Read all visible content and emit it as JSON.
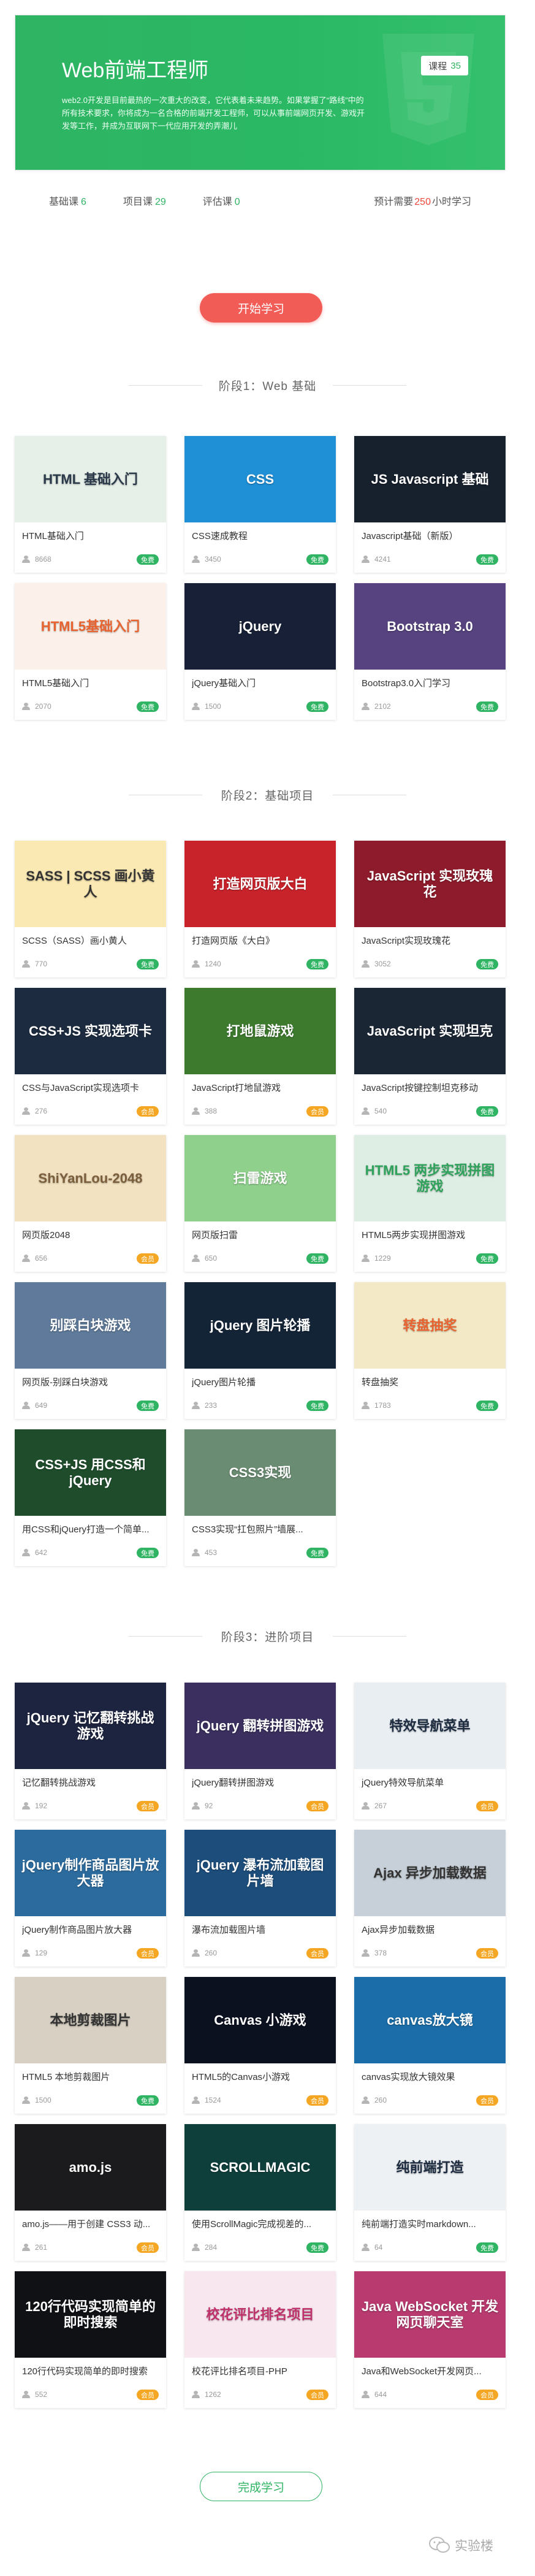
{
  "path": {
    "title": "Web前端工程师",
    "badge_label": "课程",
    "badge_count": "35",
    "description": "web2.0开发是目前最热的一次重大的改变，它代表着未来趋势。如果掌握了“路线”中的所有技术要求，你将成为一名合格的前端开发工程师，可以从事前端网页开发、游戏开发等工作，并成为互联网下一代应用开发的弄潮儿",
    "stats": [
      {
        "label": "基础课",
        "value": "6"
      },
      {
        "label": "项目课",
        "value": "29"
      },
      {
        "label": "评估课",
        "value": "0"
      }
    ],
    "estimate_prefix": "预计需要",
    "estimate_value": "250",
    "estimate_suffix": "小时学习"
  },
  "buttons": {
    "start": "开始学习",
    "finish": "完成学习"
  },
  "stages": [
    {
      "title": "阶段1：Web 基础",
      "courses": [
        {
          "title": "HTML基础入门",
          "learners": "8668",
          "badge": "免费",
          "thumb": {
            "text": "HTML 基础入门",
            "bg": "#e7efe9",
            "fg": "#2b3a4a"
          }
        },
        {
          "title": "CSS速成教程",
          "learners": "3450",
          "badge": "免费",
          "thumb": {
            "text": "CSS",
            "bg": "#1f8fd6",
            "fg": "#ffffff"
          }
        },
        {
          "title": "Javascript基础（新版）",
          "learners": "4241",
          "badge": "免费",
          "thumb": {
            "text": "JS Javascript 基础",
            "bg": "#17202d",
            "fg": "#ffffff"
          }
        },
        {
          "title": "HTML5基础入门",
          "learners": "2070",
          "badge": "免费",
          "thumb": {
            "text": "HTML5基础入门",
            "bg": "#fbf1ea",
            "fg": "#e8632f"
          }
        },
        {
          "title": "jQuery基础入门",
          "learners": "1500",
          "badge": "免费",
          "thumb": {
            "text": "jQuery",
            "bg": "#172036",
            "fg": "#ffffff"
          }
        },
        {
          "title": "Bootstrap3.0入门学习",
          "learners": "2102",
          "badge": "免费",
          "thumb": {
            "text": "Bootstrap 3.0",
            "bg": "#56437f",
            "fg": "#ffffff"
          }
        }
      ]
    },
    {
      "title": "阶段2：基础项目",
      "courses": [
        {
          "title": "SCSS（SASS）画小黄人",
          "learners": "770",
          "badge": "免费",
          "thumb": {
            "text": "SASS | SCSS 画小黄人",
            "bg": "#fbe9b3",
            "fg": "#333333"
          }
        },
        {
          "title": "打造网页版《大白》",
          "learners": "1240",
          "badge": "免费",
          "thumb": {
            "text": "打造网页版大白",
            "bg": "#c8232b",
            "fg": "#ffffff"
          }
        },
        {
          "title": "JavaScript实现玫瑰花",
          "learners": "3052",
          "badge": "免费",
          "thumb": {
            "text": "JavaScript 实现玫瑰花",
            "bg": "#8e1b2b",
            "fg": "#ffffff"
          }
        },
        {
          "title": "CSS与JavaScript实现选项卡",
          "learners": "276",
          "badge": "会员",
          "thumb": {
            "text": "CSS+JS 实现选项卡",
            "bg": "#1c2b3f",
            "fg": "#ffffff"
          }
        },
        {
          "title": "JavaScript打地鼠游戏",
          "learners": "388",
          "badge": "会员",
          "thumb": {
            "text": "打地鼠游戏",
            "bg": "#3d7a2e",
            "fg": "#ffffff"
          }
        },
        {
          "title": "JavaScript按键控制坦克移动",
          "learners": "540",
          "badge": "免费",
          "thumb": {
            "text": "JavaScript 实现坦克",
            "bg": "#1b2634",
            "fg": "#ffffff"
          }
        },
        {
          "title": "网页版2048",
          "learners": "656",
          "badge": "会员",
          "thumb": {
            "text": "ShiYanLou-2048",
            "bg": "#f3e2c2",
            "fg": "#7b5e3b"
          }
        },
        {
          "title": "网页版扫雷",
          "learners": "650",
          "badge": "免费",
          "thumb": {
            "text": "扫雷游戏",
            "bg": "#8fd08d",
            "fg": "#ffffff"
          }
        },
        {
          "title": "HTML5两步实现拼图游戏",
          "learners": "1229",
          "badge": "免费",
          "thumb": {
            "text": "HTML5 两步实现拼图游戏",
            "bg": "#dfeee4",
            "fg": "#2fa35c"
          }
        },
        {
          "title": "网页版-别踩白块游戏",
          "learners": "649",
          "badge": "免费",
          "thumb": {
            "text": "别踩白块游戏",
            "bg": "#5f7a9a",
            "fg": "#ffffff"
          }
        },
        {
          "title": "jQuery图片轮播",
          "learners": "233",
          "badge": "免费",
          "thumb": {
            "text": "jQuery 图片轮播",
            "bg": "#142437",
            "fg": "#ffffff"
          }
        },
        {
          "title": "转盘抽奖",
          "learners": "1783",
          "badge": "免费",
          "thumb": {
            "text": "转盘抽奖",
            "bg": "#f3e9c6",
            "fg": "#e8632f"
          }
        },
        {
          "title": "用CSS和jQuery打造一个简单...",
          "learners": "642",
          "badge": "免费",
          "thumb": {
            "text": "CSS+JS 用CSS和jQuery",
            "bg": "#1f4d2c",
            "fg": "#ffffff"
          }
        },
        {
          "title": "CSS3实现“扛包照片”墙展...",
          "learners": "453",
          "badge": "免费",
          "thumb": {
            "text": "CSS3实现",
            "bg": "#6a8c72",
            "fg": "#ffffff"
          }
        }
      ]
    },
    {
      "title": "阶段3：进阶项目",
      "courses": [
        {
          "title": "记忆翻转挑战游戏",
          "learners": "192",
          "badge": "会员",
          "thumb": {
            "text": "jQuery 记忆翻转挑战游戏",
            "bg": "#1d2440",
            "fg": "#ffffff"
          }
        },
        {
          "title": "jQuery翻转拼图游戏",
          "learners": "92",
          "badge": "会员",
          "thumb": {
            "text": "jQuery 翻转拼图游戏",
            "bg": "#3a2f5e",
            "fg": "#ffffff"
          }
        },
        {
          "title": "jQuery特效导航菜单",
          "learners": "267",
          "badge": "会员",
          "thumb": {
            "text": "特效导航菜单",
            "bg": "#e9eef3",
            "fg": "#1c2b3f"
          }
        },
        {
          "title": "jQuery制作商品图片放大器",
          "learners": "129",
          "badge": "会员",
          "thumb": {
            "text": "jQuery制作商品图片放大器",
            "bg": "#2c6b9e",
            "fg": "#ffffff"
          }
        },
        {
          "title": "瀑布流加载图片墙",
          "learners": "260",
          "badge": "会员",
          "thumb": {
            "text": "jQuery 瀑布流加载图片墙",
            "bg": "#1d4d7b",
            "fg": "#ffffff"
          }
        },
        {
          "title": "Ajax异步加载数据",
          "learners": "378",
          "badge": "会员",
          "thumb": {
            "text": "Ajax 异步加载数据",
            "bg": "#c7d0d8",
            "fg": "#333333"
          }
        },
        {
          "title": "HTML5 本地剪裁图片",
          "learners": "1500",
          "badge": "免费",
          "thumb": {
            "text": "本地剪裁图片",
            "bg": "#d7d0c3",
            "fg": "#333333"
          }
        },
        {
          "title": "HTML5的Canvas小游戏",
          "learners": "1524",
          "badge": "会员",
          "thumb": {
            "text": "Canvas 小游戏",
            "bg": "#0c1120",
            "fg": "#ffffff"
          }
        },
        {
          "title": "canvas实现放大镜效果",
          "learners": "260",
          "badge": "会员",
          "thumb": {
            "text": "canvas放大镜",
            "bg": "#1a6da8",
            "fg": "#ffffff"
          }
        },
        {
          "title": "amo.js——用于创建 CSS3 动...",
          "learners": "261",
          "badge": "会员",
          "thumb": {
            "text": "amo.js",
            "bg": "#1b1b1d",
            "fg": "#ffffff"
          }
        },
        {
          "title": "使用ScrollMagic完成视差的...",
          "learners": "284",
          "badge": "免费",
          "thumb": {
            "text": "SCROLLMAGIC",
            "bg": "#0f3f3b",
            "fg": "#ffffff"
          }
        },
        {
          "title": "纯前端打造实时markdown...",
          "learners": "64",
          "badge": "免费",
          "thumb": {
            "text": "纯前端打造",
            "bg": "#eef1f4",
            "fg": "#1c2b3f"
          }
        },
        {
          "title": "120行代码实现简单的即时搜索",
          "learners": "552",
          "badge": "会员",
          "thumb": {
            "text": "120行代码实现简单的即时搜索",
            "bg": "#0f1114",
            "fg": "#ffffff"
          }
        },
        {
          "title": "校花评比排名项目-PHP",
          "learners": "1262",
          "badge": "会员",
          "thumb": {
            "text": "校花评比排名项目",
            "bg": "#f8e7ef",
            "fg": "#c0306a"
          }
        },
        {
          "title": "Java和WebSocket开发网页...",
          "learners": "644",
          "badge": "会员",
          "thumb": {
            "text": "Java WebSocket 开发网页聊天室",
            "bg": "#b83a6f",
            "fg": "#ffffff"
          }
        }
      ]
    }
  ],
  "watermark": "实验楼",
  "colors": {
    "accent": "#2fb463",
    "red": "#f25c57",
    "vip": "#f5a623"
  }
}
